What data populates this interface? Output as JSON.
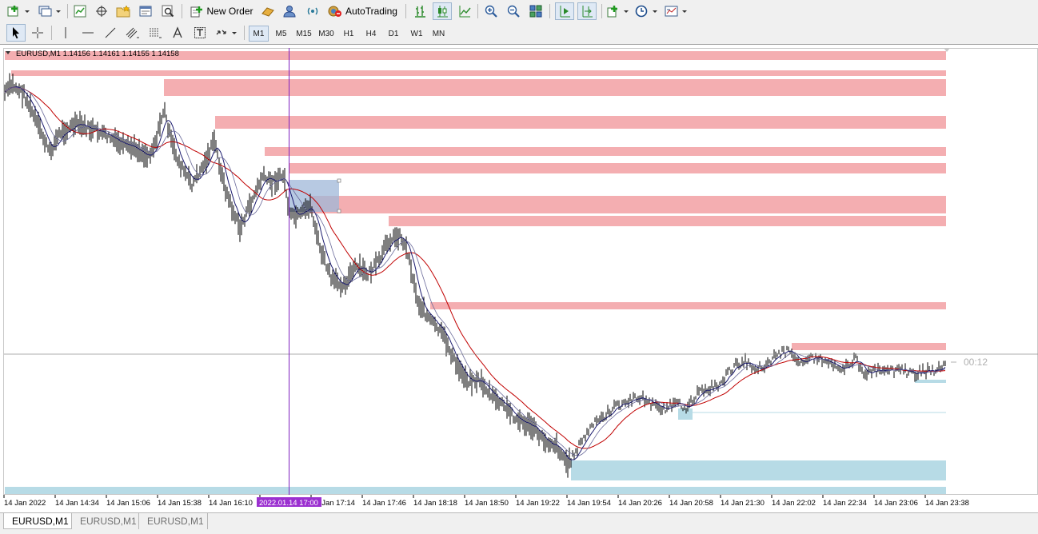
{
  "toolbar": {
    "new_order_label": "New Order",
    "autotrading_label": "AutoTrading"
  },
  "timeframes": [
    "M1",
    "M5",
    "M15",
    "M30",
    "H1",
    "H4",
    "D1",
    "W1",
    "MN"
  ],
  "chart": {
    "header_label": "EURUSD,M1  1.14156 1.14161 1.14155 1.14158",
    "countdown": "00:12",
    "crosshair_time_label": "2022.01.14 17:00",
    "time_labels": [
      "14 Jan 2022",
      "14 Jan 14:34",
      "14 Jan 15:06",
      "14 Jan 15:38",
      "14 Jan 16:10",
      "14 Jan 16:42",
      "14 Jan 17:14",
      "14 Jan 17:46",
      "14 Jan 18:18",
      "14 Jan 18:50",
      "14 Jan 19:22",
      "14 Jan 19:54",
      "14 Jan 20:26",
      "14 Jan 20:58",
      "14 Jan 21:30",
      "14 Jan 22:02",
      "14 Jan 22:34",
      "14 Jan 23:06",
      "14 Jan 23:38"
    ],
    "colors": {
      "supply_zone": "#f4aeb1",
      "demand_zone": "#b7dbe6",
      "price_line": "#000000",
      "ma_fast": "#1a1a6e",
      "ma_slow": "#c00000",
      "crosshair": "#8020c0",
      "crosshair_label_bg": "#9b30d0"
    }
  },
  "tabs": [
    {
      "label": "EURUSD,M1"
    },
    {
      "label": "EURUSD,M1"
    },
    {
      "label": "EURUSD,M1"
    }
  ]
}
